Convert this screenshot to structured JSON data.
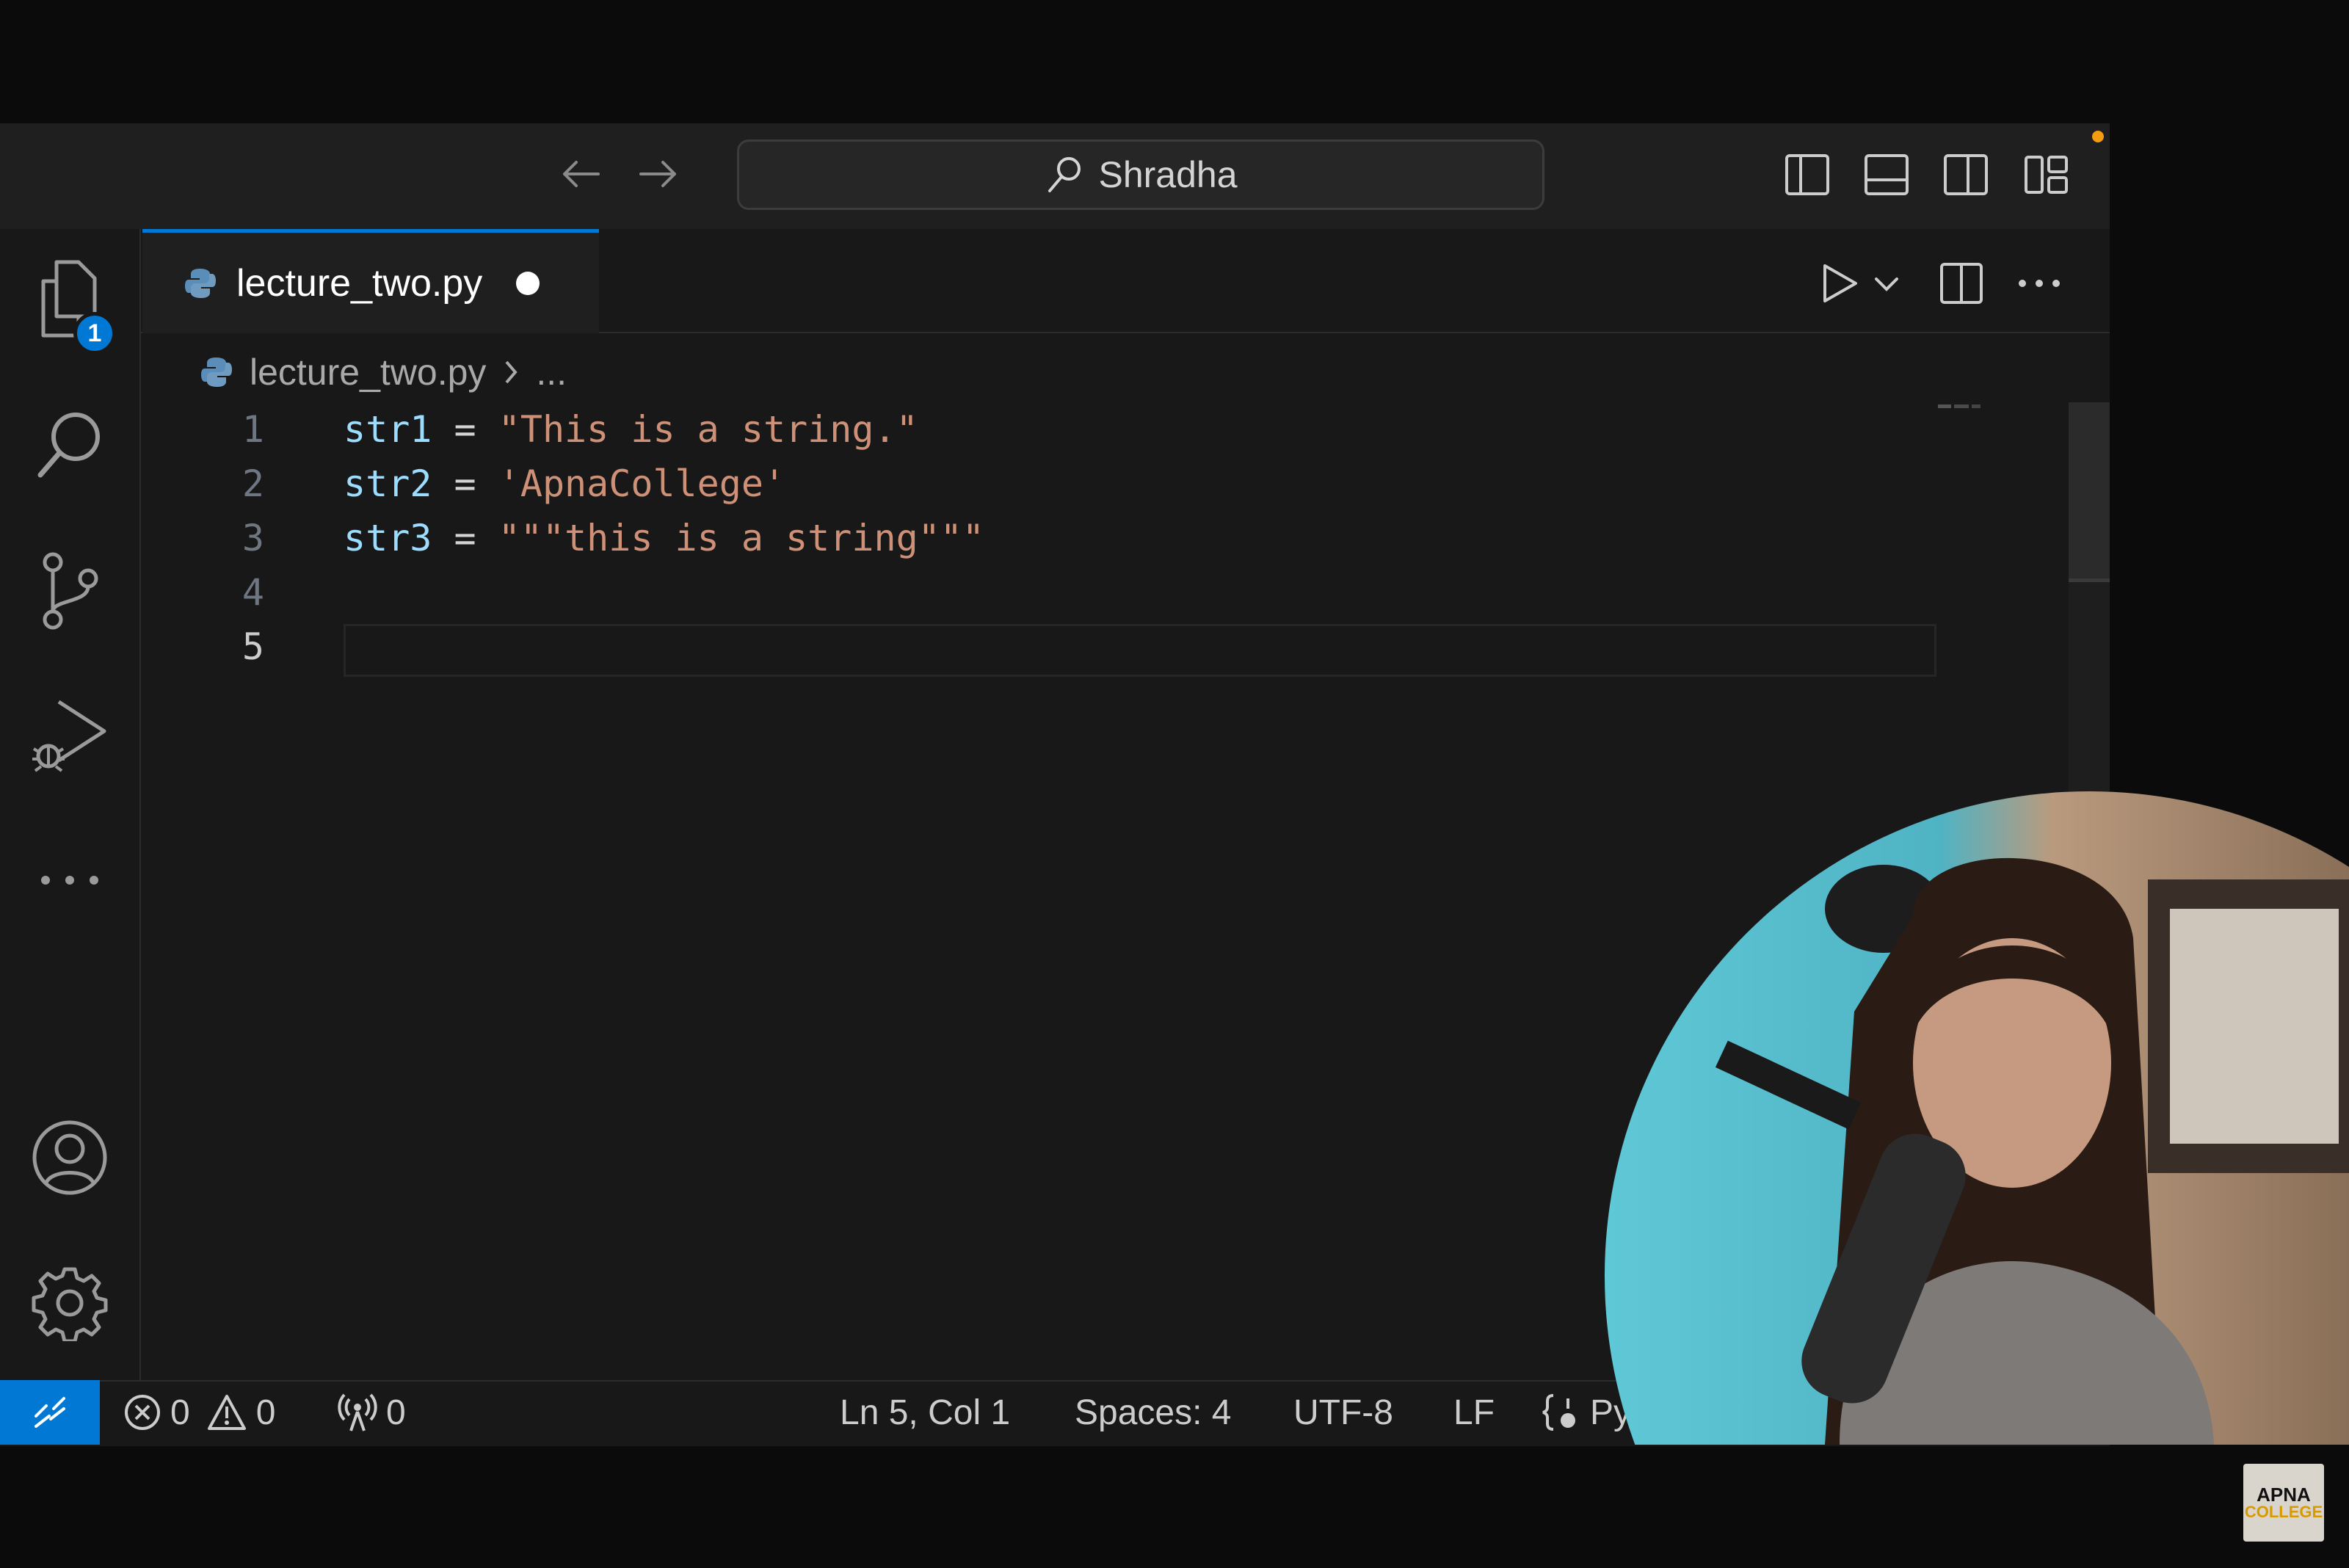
{
  "search": {
    "text": "Shradha"
  },
  "explorer_badge": "1",
  "tab": {
    "filename": "lecture_two.py"
  },
  "breadcrumb": {
    "file": "lecture_two.py",
    "rest": "..."
  },
  "code_lines": [
    {
      "num": "1",
      "var": "str1",
      "op": " = ",
      "str": "\"This is a string.\""
    },
    {
      "num": "2",
      "var": "str2",
      "op": " = ",
      "str": "'ApnaCollege'"
    },
    {
      "num": "3",
      "var": "str3",
      "op": " = ",
      "str": "\"\"\"this is a string\"\"\""
    },
    {
      "num": "4",
      "var": "",
      "op": "",
      "str": ""
    },
    {
      "num": "5",
      "var": "",
      "op": "",
      "str": ""
    }
  ],
  "status": {
    "errors": "0",
    "warnings": "0",
    "ports": "0",
    "position": "Ln 5, Col 1",
    "spaces": "Spaces: 4",
    "encoding": "UTF-8",
    "eol": "LF",
    "language": "Pyt"
  },
  "logo": {
    "line1": "APNA",
    "line2": "COLLEGE"
  },
  "colors": {
    "accent": "#0078d4",
    "editor_bg": "#181818",
    "string": "#ce9178",
    "variable": "#9cdcfe",
    "modified_dot": "#f39c12"
  },
  "icons": [
    "arrow-left-icon",
    "arrow-right-icon",
    "search-icon",
    "python-file-icon",
    "explorer-icon",
    "source-control-icon",
    "run-debug-icon",
    "account-icon",
    "gear-icon",
    "run-icon",
    "split-editor-icon",
    "more-icon",
    "remote-icon",
    "error-icon",
    "warning-icon",
    "broadcast-icon",
    "braces-icon"
  ]
}
